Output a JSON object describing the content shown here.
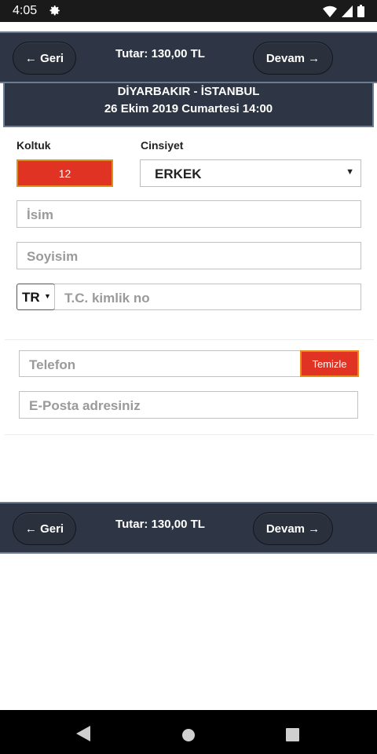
{
  "status_bar": {
    "time": "4:05",
    "icons": [
      "gear-icon",
      "wifi-icon",
      "signal-icon",
      "battery-icon"
    ]
  },
  "top_nav": {
    "back_label": "← Geri",
    "total_label": "Tutar: 130,00 TL",
    "next_label": "Devam →"
  },
  "route": {
    "line1": "DİYARBAKIR - İSTANBUL",
    "line2": "26 Ekim 2019 Cumartesi 14:00"
  },
  "passenger": {
    "seat_label": "Koltuk",
    "seat_value": "12",
    "gender_label": "Cinsiyet",
    "gender_value": "ERKEK",
    "first_name_placeholder": "İsim",
    "last_name_placeholder": "Soyisim",
    "country_code": "TR",
    "id_placeholder": "T.C. kimlik no"
  },
  "contact": {
    "phone_placeholder": "Telefon",
    "clear_label": "Temizle",
    "email_placeholder": "E-Posta adresiniz"
  },
  "bottom_nav": {
    "back_label": "← Geri",
    "total_label": "Tutar: 130,00 TL",
    "next_label": "Devam →"
  },
  "system_nav": {
    "icons": [
      "back-triangle-icon",
      "home-circle-icon",
      "recents-square-icon"
    ]
  },
  "colors": {
    "header_bg": "#2e3545",
    "accent_red": "#e03323",
    "accent_orange": "#e88a1a"
  }
}
